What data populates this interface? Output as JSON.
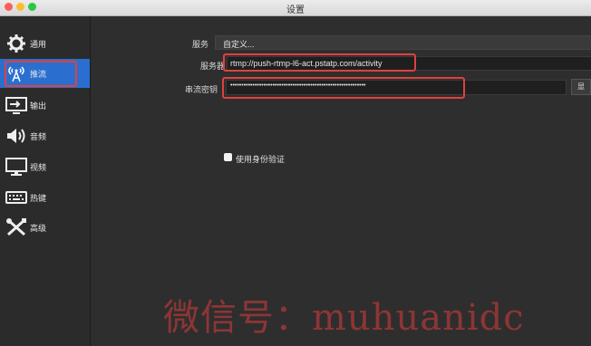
{
  "window": {
    "title": "设置"
  },
  "sidebar": {
    "items": [
      {
        "label": "通用",
        "icon": "gear-icon"
      },
      {
        "label": "推流",
        "icon": "broadcast-icon",
        "active": true
      },
      {
        "label": "输出",
        "icon": "output-icon"
      },
      {
        "label": "音频",
        "icon": "speaker-icon"
      },
      {
        "label": "视频",
        "icon": "monitor-icon"
      },
      {
        "label": "热键",
        "icon": "keyboard-icon"
      },
      {
        "label": "高级",
        "icon": "tools-icon"
      }
    ]
  },
  "stream": {
    "service_label": "服务",
    "service_value": "自定义...",
    "server_label": "服务器",
    "server_value": "rtmp://push-rtmp-l6-act.pstatp.com/activity",
    "key_label": "串流密钥",
    "key_value": "•••••••••••••••••••••••••••••••••••••••••••••••••••••••••••••",
    "key_button": "显",
    "auth_label": "使用身份验证"
  },
  "watermark": "微信号：muhuanidc",
  "colors": {
    "accent": "#2a6fd0",
    "highlight": "#e0413c"
  }
}
